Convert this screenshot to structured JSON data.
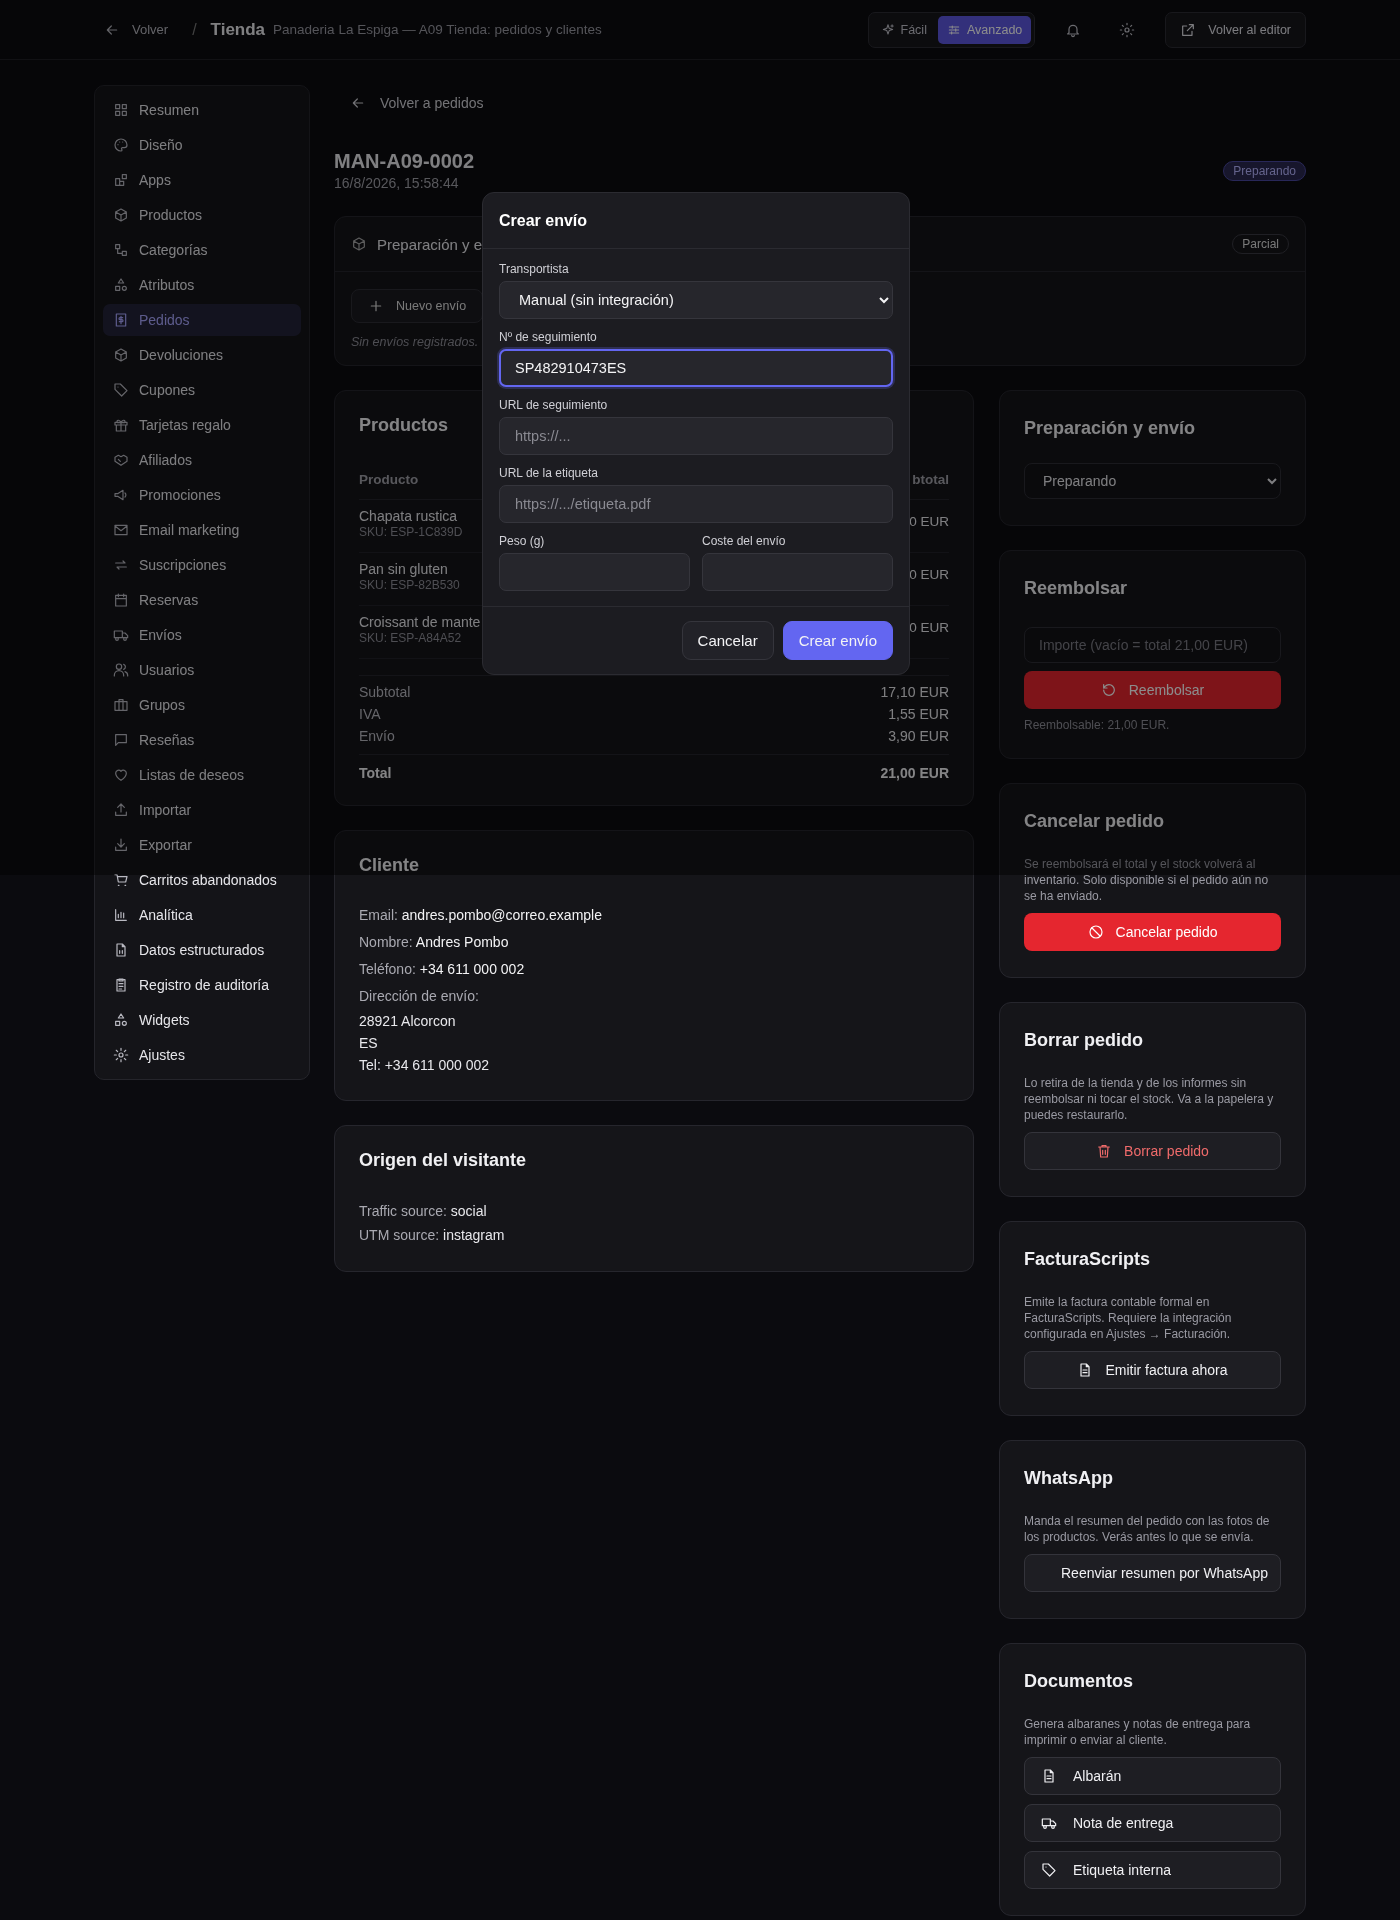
{
  "header": {
    "back": "Volver",
    "separator": "/",
    "title": "Tienda",
    "subtitle": "Panaderia La Espiga — A09 Tienda: pedidos y clientes",
    "modes": [
      {
        "label": "Fácil",
        "selected": false
      },
      {
        "label": "Avanzado",
        "selected": true
      }
    ],
    "editor_button": "Volver al editor"
  },
  "sidebar": {
    "items": [
      {
        "label": "Resumen",
        "selected": false
      },
      {
        "label": "Diseño",
        "selected": false
      },
      {
        "label": "Apps",
        "selected": false
      },
      {
        "label": "Productos",
        "selected": false
      },
      {
        "label": "Categorías",
        "selected": false
      },
      {
        "label": "Atributos",
        "selected": false
      },
      {
        "label": "Pedidos",
        "selected": true
      },
      {
        "label": "Devoluciones",
        "selected": false
      },
      {
        "label": "Cupones",
        "selected": false
      },
      {
        "label": "Tarjetas regalo",
        "selected": false
      },
      {
        "label": "Afiliados",
        "selected": false
      },
      {
        "label": "Promociones",
        "selected": false
      },
      {
        "label": "Email marketing",
        "selected": false
      },
      {
        "label": "Suscripciones",
        "selected": false
      },
      {
        "label": "Reservas",
        "selected": false
      },
      {
        "label": "Envíos",
        "selected": false
      },
      {
        "label": "Usuarios",
        "selected": false
      },
      {
        "label": "Grupos",
        "selected": false
      },
      {
        "label": "Reseñas",
        "selected": false
      },
      {
        "label": "Listas de deseos",
        "selected": false
      },
      {
        "label": "Importar",
        "selected": false
      },
      {
        "label": "Exportar",
        "selected": false
      },
      {
        "label": "Carritos abandonados",
        "selected": false
      },
      {
        "label": "Analítica",
        "selected": false
      },
      {
        "label": "Datos estructurados",
        "selected": false
      },
      {
        "label": "Registro de auditoría",
        "selected": false
      },
      {
        "label": "Widgets",
        "selected": false
      },
      {
        "label": "Ajustes",
        "selected": false
      }
    ]
  },
  "order": {
    "back_link": "Volver a pedidos",
    "number": "MAN-A09-0002",
    "date": "16/8/2026, 15:58:44",
    "status": "Preparando"
  },
  "shipments": {
    "title": "Preparación y e",
    "badge": "Parcial",
    "new_button": "Nuevo envío",
    "empty": "Sin envíos registrados."
  },
  "products": {
    "title": "Productos",
    "columns": [
      "Producto",
      "btotal"
    ],
    "rows": [
      {
        "name": "Chapata rustica",
        "sku": "SKU: ESP-1C839D",
        "subtotal": "0 EUR"
      },
      {
        "name": "Pan sin gluten",
        "sku": "SKU: ESP-82B530",
        "subtotal": "0 EUR"
      },
      {
        "name": "Croissant de mante",
        "sku": "SKU: ESP-A84A52",
        "subtotal": "0 EUR"
      }
    ],
    "totals": [
      {
        "label": "Subtotal",
        "value": "17,10 EUR"
      },
      {
        "label": "IVA",
        "value": "1,55 EUR"
      },
      {
        "label": "Envío",
        "value": "3,90 EUR"
      }
    ],
    "total": {
      "label": "Total",
      "value": "21,00 EUR"
    }
  },
  "customer": {
    "title": "Cliente",
    "fields": [
      {
        "label": "Email:",
        "value": "andres.pombo@correo.example"
      },
      {
        "label": "Nombre:",
        "value": "Andres Pombo"
      },
      {
        "label": "Teléfono:",
        "value": "+34 611 000 002"
      }
    ],
    "address_label": "Dirección de envío:",
    "address_lines": [
      "28921 Alcorcon",
      "ES",
      "Tel: +34 611 000 002"
    ]
  },
  "visitor": {
    "title": "Origen del visitante",
    "fields": [
      {
        "label": "Traffic source:",
        "value": "social"
      },
      {
        "label": "UTM source:",
        "value": "instagram"
      }
    ]
  },
  "side_cards": [
    {
      "kind": "select",
      "title": "Preparación y envío",
      "value": "Preparando"
    },
    {
      "kind": "refund",
      "title": "Reembolsar",
      "placeholder": "Importe (vacío = total 21,00 EUR)",
      "buttons": [
        {
          "label": "Reembolsar"
        }
      ],
      "note": "Reembolsable: 21,00 EUR."
    },
    {
      "kind": "action",
      "title": "Cancelar pedido",
      "description": "Se reembolsará el total y el stock volverá al inventario. Solo disponible si el pedido aún no se ha enviado.",
      "buttons": [
        {
          "label": "Cancelar pedido"
        }
      ]
    },
    {
      "kind": "action",
      "title": "Borrar pedido",
      "description": "Lo retira de la tienda y de los informes sin reembolsar ni tocar el stock. Va a la papelera y puedes restaurarlo.",
      "buttons": [
        {
          "label": "Borrar pedido"
        }
      ]
    },
    {
      "kind": "action",
      "title": "FacturaScripts",
      "description": "Emite la factura contable formal en FacturaScripts. Requiere la integración configurada en Ajustes → Facturación.",
      "buttons": [
        {
          "label": "Emitir factura ahora"
        }
      ]
    },
    {
      "kind": "action",
      "title": "WhatsApp",
      "description": "Manda el resumen del pedido con las fotos de los productos. Verás antes lo que se envía.",
      "buttons": [
        {
          "label": "Reenviar resumen por WhatsApp"
        }
      ]
    },
    {
      "kind": "documents",
      "title": "Documentos",
      "description": "Genera albaranes y notas de entrega para imprimir o enviar al cliente.",
      "buttons": [
        {
          "label": "Albarán"
        },
        {
          "label": "Nota de entrega"
        },
        {
          "label": "Etiqueta interna"
        }
      ]
    }
  ],
  "modal": {
    "title": "Crear envío",
    "fields": [
      {
        "label": "Transportista",
        "kind": "select",
        "value": "Manual (sin integración)",
        "focused": false
      },
      {
        "label": "Nº de seguimiento",
        "kind": "text",
        "value": "SP482910473ES",
        "focused": true
      },
      {
        "label": "URL de seguimiento",
        "kind": "text",
        "placeholder": "https://...",
        "focused": false
      },
      {
        "label": "URL de la etiqueta",
        "kind": "text",
        "placeholder": "https://.../etiqueta.pdf",
        "focused": false
      }
    ],
    "pair": [
      {
        "label": "Peso (g)",
        "kind": "text",
        "focused": false
      },
      {
        "label": "Coste del envío",
        "kind": "text",
        "focused": false
      }
    ],
    "buttons": [
      {
        "label": "Cancelar",
        "kind": "secondary"
      },
      {
        "label": "Crear envío",
        "kind": "primary"
      }
    ]
  }
}
